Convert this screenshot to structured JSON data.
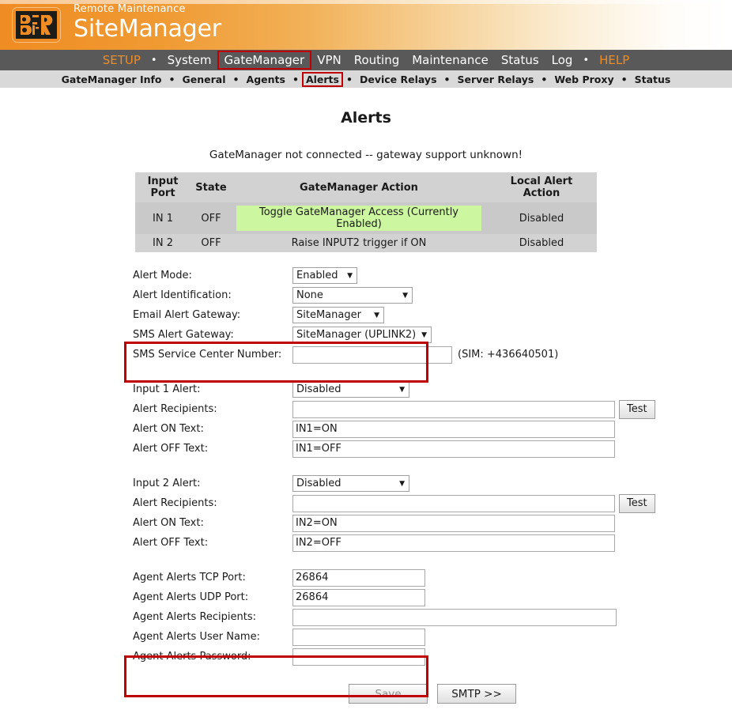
{
  "banner": {
    "subtitle": "Remote Maintenance",
    "title": "SiteManager",
    "logo_icon": "bur-logo-icon"
  },
  "mainnav": {
    "items": [
      {
        "label": "SETUP",
        "accent": true,
        "boxed": false
      },
      {
        "label": "System",
        "accent": false,
        "boxed": false
      },
      {
        "label": "GateManager",
        "accent": false,
        "boxed": true
      },
      {
        "label": "VPN",
        "accent": false,
        "boxed": false
      },
      {
        "label": "Routing",
        "accent": false,
        "boxed": false
      },
      {
        "label": "Maintenance",
        "accent": false,
        "boxed": false
      },
      {
        "label": "Status",
        "accent": false,
        "boxed": false
      },
      {
        "label": "Log",
        "accent": false,
        "boxed": false
      },
      {
        "label": "HELP",
        "accent": true,
        "boxed": false
      }
    ],
    "separator": "•"
  },
  "subnav": {
    "items": [
      {
        "label": "GateManager Info",
        "boxed": false
      },
      {
        "label": "General",
        "boxed": false
      },
      {
        "label": "Agents",
        "boxed": false
      },
      {
        "label": "Alerts",
        "boxed": true
      },
      {
        "label": "Device Relays",
        "boxed": false
      },
      {
        "label": "Server Relays",
        "boxed": false
      },
      {
        "label": "Web Proxy",
        "boxed": false
      },
      {
        "label": "Status",
        "boxed": false
      }
    ],
    "separator": "•"
  },
  "page": {
    "title": "Alerts",
    "status_message": "GateManager not connected -- gateway support unknown!"
  },
  "status_table": {
    "headers": [
      "Input Port",
      "State",
      "GateManager Action",
      "Local Alert Action"
    ],
    "rows": [
      {
        "input_port": "IN 1",
        "state": "OFF",
        "gatemanager_action": "Toggle GateManager Access (Currently Enabled)",
        "gatemanager_action_highlight": true,
        "local_alert_action": "Disabled"
      },
      {
        "input_port": "IN 2",
        "state": "OFF",
        "gatemanager_action": "Raise INPUT2 trigger if ON",
        "gatemanager_action_highlight": false,
        "local_alert_action": "Disabled"
      }
    ]
  },
  "form": {
    "alert_mode": {
      "label": "Alert Mode:",
      "value": "Enabled"
    },
    "alert_identification": {
      "label": "Alert Identification:",
      "value": "None"
    },
    "email_alert_gateway": {
      "label": "Email Alert Gateway:",
      "value": "SiteManager"
    },
    "sms_alert_gateway": {
      "label": "SMS Alert Gateway:",
      "value": "SiteManager (UPLINK2)"
    },
    "sms_service_center": {
      "label": "SMS Service Center Number:",
      "value": "",
      "placeholder": "",
      "note": "(SIM: +436640501)"
    },
    "input1": {
      "alert_label": "Input 1 Alert:",
      "alert_value": "Disabled",
      "recipients_label": "Alert Recipients:",
      "recipients_value": "",
      "test_button": "Test",
      "on_text_label": "Alert ON Text:",
      "on_text_value": "IN1=ON",
      "off_text_label": "Alert OFF Text:",
      "off_text_value": "IN1=OFF"
    },
    "input2": {
      "alert_label": "Input 2 Alert:",
      "alert_value": "Disabled",
      "recipients_label": "Alert Recipients:",
      "recipients_value": "",
      "test_button": "Test",
      "on_text_label": "Alert ON Text:",
      "on_text_value": "IN2=ON",
      "off_text_label": "Alert OFF Text:",
      "off_text_value": "IN2=OFF"
    },
    "agent": {
      "tcp_port_label": "Agent Alerts TCP Port:",
      "tcp_port_value": "26864",
      "udp_port_label": "Agent Alerts UDP Port:",
      "udp_port_value": "26864",
      "recipients_label": "Agent Alerts Recipients:",
      "recipients_value": "",
      "username_label": "Agent Alerts User Name:",
      "username_value": "",
      "password_label": "Agent Alerts Password:",
      "password_value": ""
    },
    "actions": {
      "save_label": "Save",
      "save_disabled": true,
      "smtp_label": "SMTP >>"
    }
  },
  "colors": {
    "brand_orange": "#ef8c23",
    "nav_bar": "#595959",
    "subnav_bar": "#d9d9d9",
    "annotation_red": "#c00000",
    "highlight_green": "#ccf7a0",
    "table_header": "#d2d2d2",
    "table_row": "#c9c9c9"
  }
}
